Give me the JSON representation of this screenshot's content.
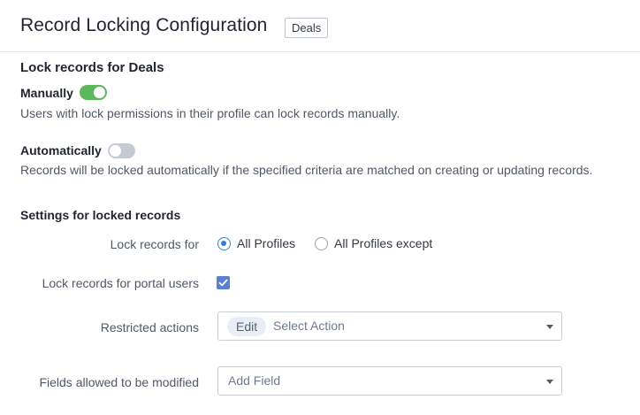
{
  "header": {
    "title": "Record Locking Configuration",
    "module_badge": "Deals"
  },
  "lock_section": {
    "title": "Lock records for Deals",
    "manual": {
      "label": "Manually",
      "enabled": true,
      "description": "Users with lock permissions in their profile can lock records manually."
    },
    "automatic": {
      "label": "Automatically",
      "enabled": false,
      "description": "Records will be locked automatically if the specified criteria are matched on creating or updating records."
    }
  },
  "settings_section": {
    "title": "Settings for locked records",
    "lock_records_for": {
      "label": "Lock records for",
      "options": [
        {
          "label": "All Profiles",
          "selected": true
        },
        {
          "label": "All Profiles except",
          "selected": false
        }
      ]
    },
    "portal_users": {
      "label": "Lock records for portal users",
      "checked": true
    },
    "restricted_actions": {
      "label": "Restricted actions",
      "chips": [
        "Edit"
      ],
      "placeholder": "Select Action"
    },
    "fields_allowed": {
      "label": "Fields allowed to be modified",
      "placeholder": "Add Field"
    }
  },
  "colors": {
    "toggle_on": "#5cb85c",
    "toggle_off": "#c6cad2",
    "radio_selected": "#2f7de1",
    "checkbox": "#5b7fd6"
  },
  "icons": {
    "toggle": "toggle-switch",
    "radio": "radio-button",
    "checkbox": "checkbox-check-icon",
    "dropdown": "chevron-down-icon"
  }
}
